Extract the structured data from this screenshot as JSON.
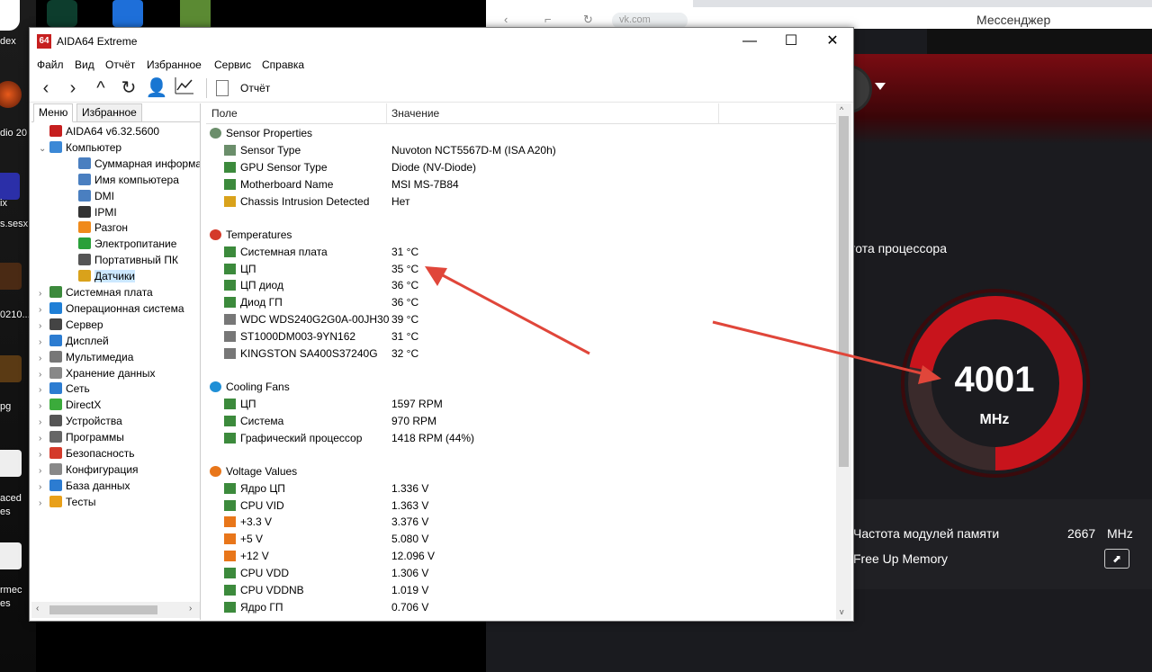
{
  "desktop": {
    "labels": [
      "dex",
      "dio 20",
      "ix",
      "s.sesx",
      "0210...",
      "pg",
      "aced",
      "es",
      "rmec",
      "es"
    ]
  },
  "browser": {
    "url": "vk.com",
    "messenger_label": "Мессенджер"
  },
  "app": {
    "freq_title": "тота процессора",
    "gauge_value": "4001",
    "gauge_unit": "MHz",
    "gauge_fraction": 0.72,
    "mem_label": "Частота модулей памяти",
    "mem_value": "2667",
    "mem_unit": "MHz",
    "free_label": "Free Up Memory",
    "accent": "#c8141c"
  },
  "window": {
    "title": "AIDA64 Extreme",
    "icon_text": "64",
    "minimize": "—",
    "maximize": "☐",
    "close": "✕"
  },
  "menu": [
    "Файл",
    "Вид",
    "Отчёт",
    "Избранное",
    "Сервис",
    "Справка"
  ],
  "toolbar": {
    "report_label": "Отчёт"
  },
  "tabs": {
    "menu": "Меню",
    "favorites": "Избранное"
  },
  "tree": [
    {
      "label": "AIDA64 v6.32.5600",
      "level": 0,
      "arrow": "",
      "icon": "aida-icon"
    },
    {
      "label": "Компьютер",
      "level": 0,
      "arrow": "⌄",
      "icon": "computer-icon"
    },
    {
      "label": "Суммарная информация",
      "level": 1,
      "arrow": "",
      "icon": "summary-icon"
    },
    {
      "label": "Имя компьютера",
      "level": 1,
      "arrow": "",
      "icon": "computer-name-icon"
    },
    {
      "label": "DMI",
      "level": 1,
      "arrow": "",
      "icon": "dmi-icon"
    },
    {
      "label": "IPMI",
      "level": 1,
      "arrow": "",
      "icon": "ipmi-icon"
    },
    {
      "label": "Разгон",
      "level": 1,
      "arrow": "",
      "icon": "overclock-icon"
    },
    {
      "label": "Электропитание",
      "level": 1,
      "arrow": "",
      "icon": "power-icon"
    },
    {
      "label": "Портативный ПК",
      "level": 1,
      "arrow": "",
      "icon": "laptop-icon"
    },
    {
      "label": "Датчики",
      "level": 1,
      "arrow": "",
      "icon": "sensor-icon",
      "selected": true
    },
    {
      "label": "Системная плата",
      "level": 0,
      "arrow": "›",
      "icon": "motherboard-icon"
    },
    {
      "label": "Операционная система",
      "level": 0,
      "arrow": "›",
      "icon": "os-icon"
    },
    {
      "label": "Сервер",
      "level": 0,
      "arrow": "›",
      "icon": "server-icon"
    },
    {
      "label": "Дисплей",
      "level": 0,
      "arrow": "›",
      "icon": "display-icon"
    },
    {
      "label": "Мультимедиа",
      "level": 0,
      "arrow": "›",
      "icon": "multimedia-icon"
    },
    {
      "label": "Хранение данных",
      "level": 0,
      "arrow": "›",
      "icon": "storage-icon"
    },
    {
      "label": "Сеть",
      "level": 0,
      "arrow": "›",
      "icon": "network-icon"
    },
    {
      "label": "DirectX",
      "level": 0,
      "arrow": "›",
      "icon": "directx-icon"
    },
    {
      "label": "Устройства",
      "level": 0,
      "arrow": "›",
      "icon": "devices-icon"
    },
    {
      "label": "Программы",
      "level": 0,
      "arrow": "›",
      "icon": "programs-icon"
    },
    {
      "label": "Безопасность",
      "level": 0,
      "arrow": "›",
      "icon": "security-icon"
    },
    {
      "label": "Конфигурация",
      "level": 0,
      "arrow": "›",
      "icon": "config-icon"
    },
    {
      "label": "База данных",
      "level": 0,
      "arrow": "›",
      "icon": "database-icon"
    },
    {
      "label": "Тесты",
      "level": 0,
      "arrow": "›",
      "icon": "tests-icon"
    }
  ],
  "columns": {
    "field": "Поле",
    "value": "Значение"
  },
  "groups": [
    {
      "title": "Sensor Properties",
      "icon": "gauge-icon",
      "rows": [
        {
          "field": "Sensor Type",
          "value": "Nuvoton NCT5567D-M  (ISA A20h)",
          "icon": "gauge-icon"
        },
        {
          "field": "GPU Sensor Type",
          "value": "Diode  (NV-Diode)",
          "icon": "gpu-icon"
        },
        {
          "field": "Motherboard Name",
          "value": "MSI MS-7B84",
          "icon": "motherboard-icon"
        },
        {
          "field": "Chassis Intrusion Detected",
          "value": "Нет",
          "icon": "shield-icon"
        }
      ]
    },
    {
      "title": "Temperatures",
      "icon": "thermometer-icon",
      "rows": [
        {
          "field": "Системная плата",
          "value": "31 °C",
          "icon": "motherboard-icon"
        },
        {
          "field": "ЦП",
          "value": "35 °C",
          "icon": "cpu-icon"
        },
        {
          "field": "ЦП диод",
          "value": "36 °C",
          "icon": "cpu-icon"
        },
        {
          "field": "Диод ГП",
          "value": "36 °C",
          "icon": "gpu-icon"
        },
        {
          "field": "WDC WDS240G2G0A-00JH30",
          "value": "39 °C",
          "icon": "disk-icon"
        },
        {
          "field": "ST1000DM003-9YN162",
          "value": "31 °C",
          "icon": "disk-icon"
        },
        {
          "field": "KINGSTON SA400S37240G",
          "value": "32 °C",
          "icon": "disk-icon"
        }
      ]
    },
    {
      "title": "Cooling Fans",
      "icon": "fan-icon",
      "rows": [
        {
          "field": "ЦП",
          "value": "1597 RPM",
          "icon": "cpu-icon"
        },
        {
          "field": "Система",
          "value": "970 RPM",
          "icon": "motherboard-icon"
        },
        {
          "field": "Графический процессор",
          "value": "1418 RPM  (44%)",
          "icon": "gpu-icon"
        }
      ]
    },
    {
      "title": "Voltage Values",
      "icon": "voltage-icon",
      "rows": [
        {
          "field": "Ядро ЦП",
          "value": "1.336 V",
          "icon": "cpu-icon"
        },
        {
          "field": "CPU VID",
          "value": "1.363 V",
          "icon": "cpu-icon"
        },
        {
          "field": "+3.3 V",
          "value": "3.376 V",
          "icon": "voltage-icon"
        },
        {
          "field": "+5 V",
          "value": "5.080 V",
          "icon": "voltage-icon"
        },
        {
          "field": "+12 V",
          "value": "12.096 V",
          "icon": "voltage-icon"
        },
        {
          "field": "CPU VDD",
          "value": "1.306 V",
          "icon": "cpu-icon"
        },
        {
          "field": "CPU VDDNB",
          "value": "1.019 V",
          "icon": "cpu-icon"
        },
        {
          "field": "Ядро ГП",
          "value": "0.706 V",
          "icon": "gpu-icon"
        }
      ]
    }
  ]
}
